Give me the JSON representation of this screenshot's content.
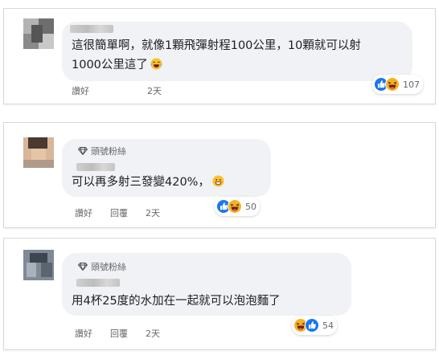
{
  "comments": [
    {
      "text_lines": [
        "這很簡單啊，就像1顆飛彈射程100公里，10顆就可以射",
        "1000公里這了"
      ],
      "actions": {
        "like": "讚好",
        "time": "2天"
      },
      "reaction_count": "107"
    },
    {
      "badge": "頭號粉絲",
      "text": "可以再多射三發變420%，",
      "actions": {
        "like": "讚好",
        "reply": "回覆",
        "time": "2天"
      },
      "reaction_count": "50"
    },
    {
      "badge": "頭號粉絲",
      "text": "用4杯25度的水加在一起就可以泡泡麵了",
      "actions": {
        "like": "讚好",
        "reply": "回覆",
        "time": "2天"
      },
      "reaction_count": "54"
    }
  ],
  "colors": {
    "like_blue": "#1877f2",
    "haha_yellow": "#f7b125",
    "bubble_bg": "#f0f2f5",
    "meta_gray": "#65676b"
  },
  "icons": [
    "diamond-icon",
    "like-reaction-icon",
    "haha-reaction-icon",
    "laughing-emoji-icon",
    "grinning-emoji-icon"
  ]
}
